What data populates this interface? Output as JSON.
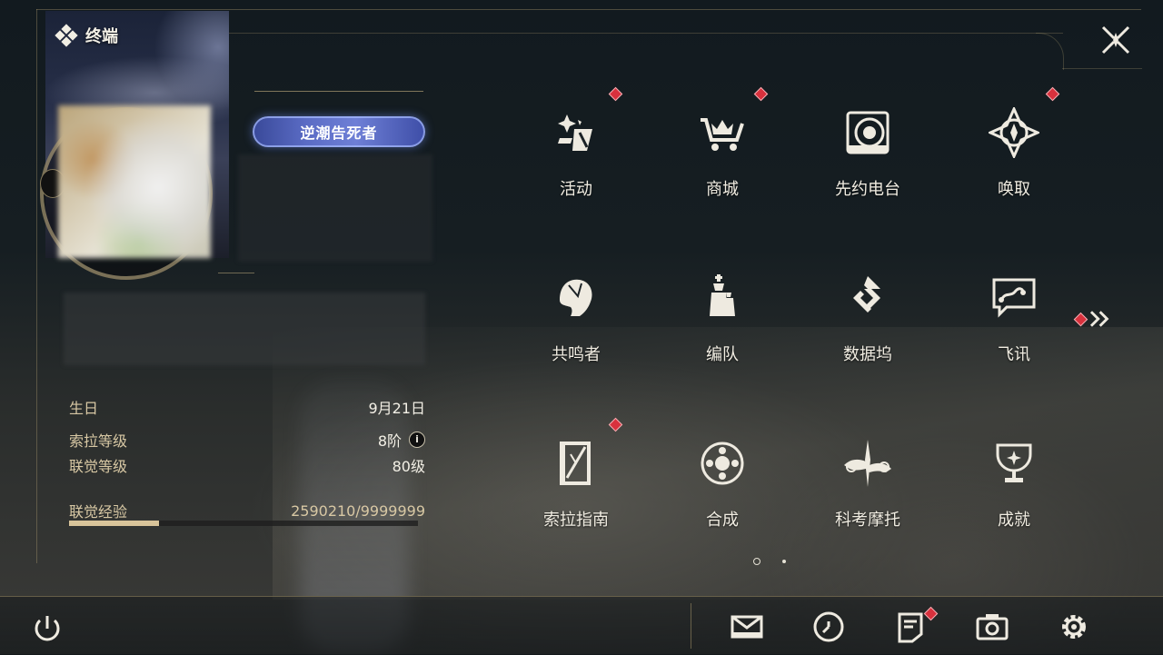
{
  "header": {
    "title": "终端"
  },
  "profile": {
    "title_badge": "逆潮告死者",
    "stats": [
      {
        "label": "生日",
        "value": "9月21日"
      },
      {
        "label": "索拉等级",
        "value": "8阶"
      },
      {
        "label": "联觉等级",
        "value": "80级"
      },
      {
        "label": "联觉经验",
        "value": "2590210/9999999"
      }
    ],
    "exp_progress": 0.259
  },
  "menu": {
    "items": [
      {
        "label": "活动",
        "icon": "activity-icon",
        "badge": true
      },
      {
        "label": "商城",
        "icon": "shop-icon",
        "badge": true
      },
      {
        "label": "先约电台",
        "icon": "radio-icon",
        "badge": false
      },
      {
        "label": "唤取",
        "icon": "summon-icon",
        "badge": true
      },
      {
        "label": "共鸣者",
        "icon": "resonator-icon",
        "badge": false
      },
      {
        "label": "编队",
        "icon": "team-icon",
        "badge": false
      },
      {
        "label": "数据坞",
        "icon": "data-bank-icon",
        "badge": false
      },
      {
        "label": "飞讯",
        "icon": "chat-icon",
        "badge": false
      },
      {
        "label": "索拉指南",
        "icon": "guide-icon",
        "badge": true
      },
      {
        "label": "合成",
        "icon": "synthesis-icon",
        "badge": false
      },
      {
        "label": "科考摩托",
        "icon": "motorcycle-icon",
        "badge": false
      },
      {
        "label": "成就",
        "icon": "achievement-icon",
        "badge": false
      }
    ],
    "next_page_badge": true,
    "pages": 2,
    "current_page": 1
  },
  "bottom_bar": {
    "buttons": [
      {
        "icon": "power-icon"
      },
      {
        "icon": "mail-icon"
      },
      {
        "icon": "clock-icon"
      },
      {
        "icon": "notice-icon",
        "badge": true
      },
      {
        "icon": "camera-icon"
      },
      {
        "icon": "settings-icon"
      }
    ]
  },
  "colors": {
    "accent_gold": "#d8c49a",
    "badge_red": "#d8313d",
    "title_badge_blue": "#5a6bc4"
  }
}
